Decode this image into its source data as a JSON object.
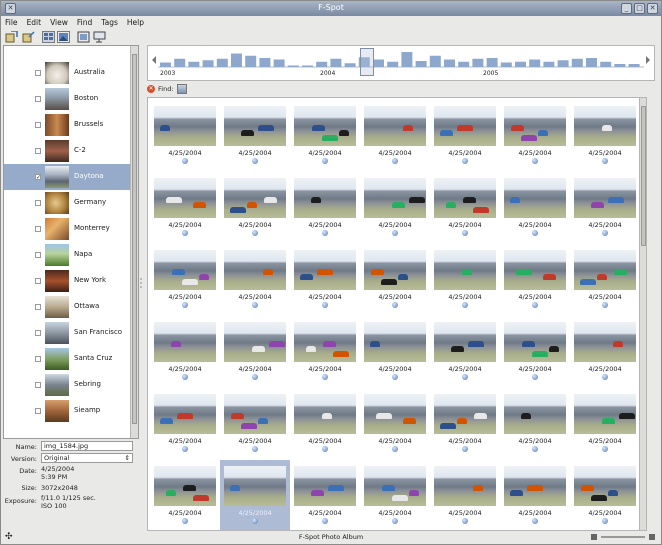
{
  "window": {
    "title": "F-Spot"
  },
  "menu": [
    "File",
    "Edit",
    "View",
    "Find",
    "Tags",
    "Help"
  ],
  "toolbar": {
    "icons": [
      "import-icon",
      "export-icon",
      "browse-view-icon",
      "edit-view-icon",
      "fullscreen-icon",
      "slideshow-icon"
    ]
  },
  "sidebar": {
    "tags": [
      {
        "name": "Australia",
        "checked": false
      },
      {
        "name": "Boston",
        "checked": false
      },
      {
        "name": "Brussels",
        "checked": false
      },
      {
        "name": "C-2",
        "checked": false
      },
      {
        "name": "Daytona",
        "checked": true
      },
      {
        "name": "Germany",
        "checked": false
      },
      {
        "name": "Monterrey",
        "checked": false
      },
      {
        "name": "Napa",
        "checked": false
      },
      {
        "name": "New York",
        "checked": false
      },
      {
        "name": "Ottawa",
        "checked": false
      },
      {
        "name": "San Francisco",
        "checked": false
      },
      {
        "name": "Santa Cruz",
        "checked": false
      },
      {
        "name": "Sebring",
        "checked": false
      },
      {
        "name": "Sieamp",
        "checked": false
      }
    ],
    "selected": "Daytona"
  },
  "info": {
    "name_label": "Name:",
    "name_value": "img_1584.jpg",
    "version_label": "Version:",
    "version_value": "Original",
    "date_label": "Date:",
    "date_value": "4/25/2004",
    "time_value": "5:39 PM",
    "size_label": "Size:",
    "size_value": "3072x2048",
    "exposure_label": "Exposure:",
    "exposure_value": "f/11.0 1/125 sec.",
    "iso_value": "ISO 100"
  },
  "timeline": {
    "years": [
      "2003",
      "2004",
      "2005"
    ],
    "bar_levels": [
      0.3,
      0.55,
      0.35,
      0.45,
      0.55,
      0.9,
      0.75,
      0.6,
      0.5,
      0.1,
      0.1,
      0.35,
      0.55,
      0.25,
      0.65,
      0.5,
      0.35,
      1.0,
      0.4,
      0.75,
      0.5,
      0.35,
      0.55,
      0.6,
      0.3,
      0.35,
      0.5,
      0.35,
      0.45,
      0.55,
      0.6,
      0.35,
      0.2,
      0.2
    ]
  },
  "find": {
    "label": "Find:"
  },
  "photos": {
    "date": "4/25/2004",
    "rows": 6,
    "columns": 7,
    "selected_index": 36
  },
  "status": {
    "text": "F-Spot Photo Album"
  }
}
